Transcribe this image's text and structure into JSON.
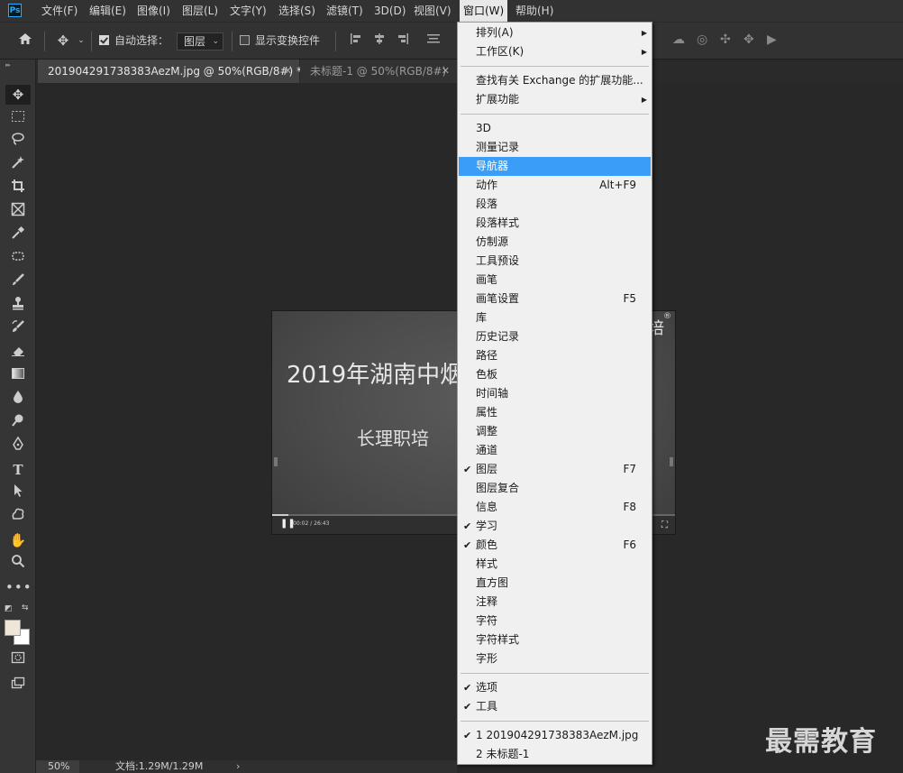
{
  "app": {
    "logo": "Ps"
  },
  "menubar": {
    "items": [
      "文件(F)",
      "编辑(E)",
      "图像(I)",
      "图层(L)",
      "文字(Y)",
      "选择(S)",
      "滤镜(T)",
      "3D(D)",
      "视图(V)",
      "窗口(W)",
      "帮助(H)"
    ],
    "active": "窗口(W)"
  },
  "options": {
    "auto_select_label": "自动选择：",
    "auto_select_checked": true,
    "layer_select_value": "图层",
    "show_transform_label": "显示变换控件",
    "show_transform_checked": false
  },
  "tabs": [
    {
      "label": "201904291738383AezM.jpg @ 50%(RGB/8#) *",
      "active": true
    },
    {
      "label": "未标题-1 @ 50%(RGB/8#)",
      "active": false
    }
  ],
  "canvas": {
    "title": "2019年湖南中烟",
    "subtitle": "长理职培",
    "corner_char": "培",
    "registered": "®",
    "time": "00:02 / 26:43",
    "progress": 0.04
  },
  "window_menu": {
    "groups": [
      [
        {
          "label": "排列(A)",
          "submenu": true
        },
        {
          "label": "工作区(K)",
          "submenu": true
        }
      ],
      [
        {
          "label": "查找有关 Exchange 的扩展功能..."
        },
        {
          "label": "扩展功能",
          "submenu": true
        }
      ],
      [
        {
          "label": "3D"
        },
        {
          "label": "测量记录"
        },
        {
          "label": "导航器",
          "highlighted": true
        },
        {
          "label": "动作",
          "shortcut": "Alt+F9"
        },
        {
          "label": "段落"
        },
        {
          "label": "段落样式"
        },
        {
          "label": "仿制源"
        },
        {
          "label": "工具预设"
        },
        {
          "label": "画笔"
        },
        {
          "label": "画笔设置",
          "shortcut": "F5"
        },
        {
          "label": "库"
        },
        {
          "label": "历史记录"
        },
        {
          "label": "路径"
        },
        {
          "label": "色板"
        },
        {
          "label": "时间轴"
        },
        {
          "label": "属性"
        },
        {
          "label": "调整"
        },
        {
          "label": "通道"
        },
        {
          "label": "图层",
          "shortcut": "F7",
          "checked": true
        },
        {
          "label": "图层复合"
        },
        {
          "label": "信息",
          "shortcut": "F8"
        },
        {
          "label": "学习",
          "checked": true
        },
        {
          "label": "颜色",
          "shortcut": "F6",
          "checked": true
        },
        {
          "label": "样式"
        },
        {
          "label": "直方图"
        },
        {
          "label": "注释"
        },
        {
          "label": "字符"
        },
        {
          "label": "字符样式"
        },
        {
          "label": "字形"
        }
      ],
      [
        {
          "label": "选项",
          "checked": true
        },
        {
          "label": "工具",
          "checked": true
        }
      ],
      [
        {
          "label": "1 201904291738383AezM.jpg",
          "checked": true
        },
        {
          "label": "2 未标题-1"
        }
      ]
    ]
  },
  "status": {
    "zoom": "50%",
    "doc_info": "文档:1.29M/1.29M",
    "arrow": "›"
  },
  "watermark": "最需教育",
  "colors": {
    "foreground": "#efe6d7",
    "background": "#ffffff",
    "menu_highlight": "#3a9df7"
  }
}
